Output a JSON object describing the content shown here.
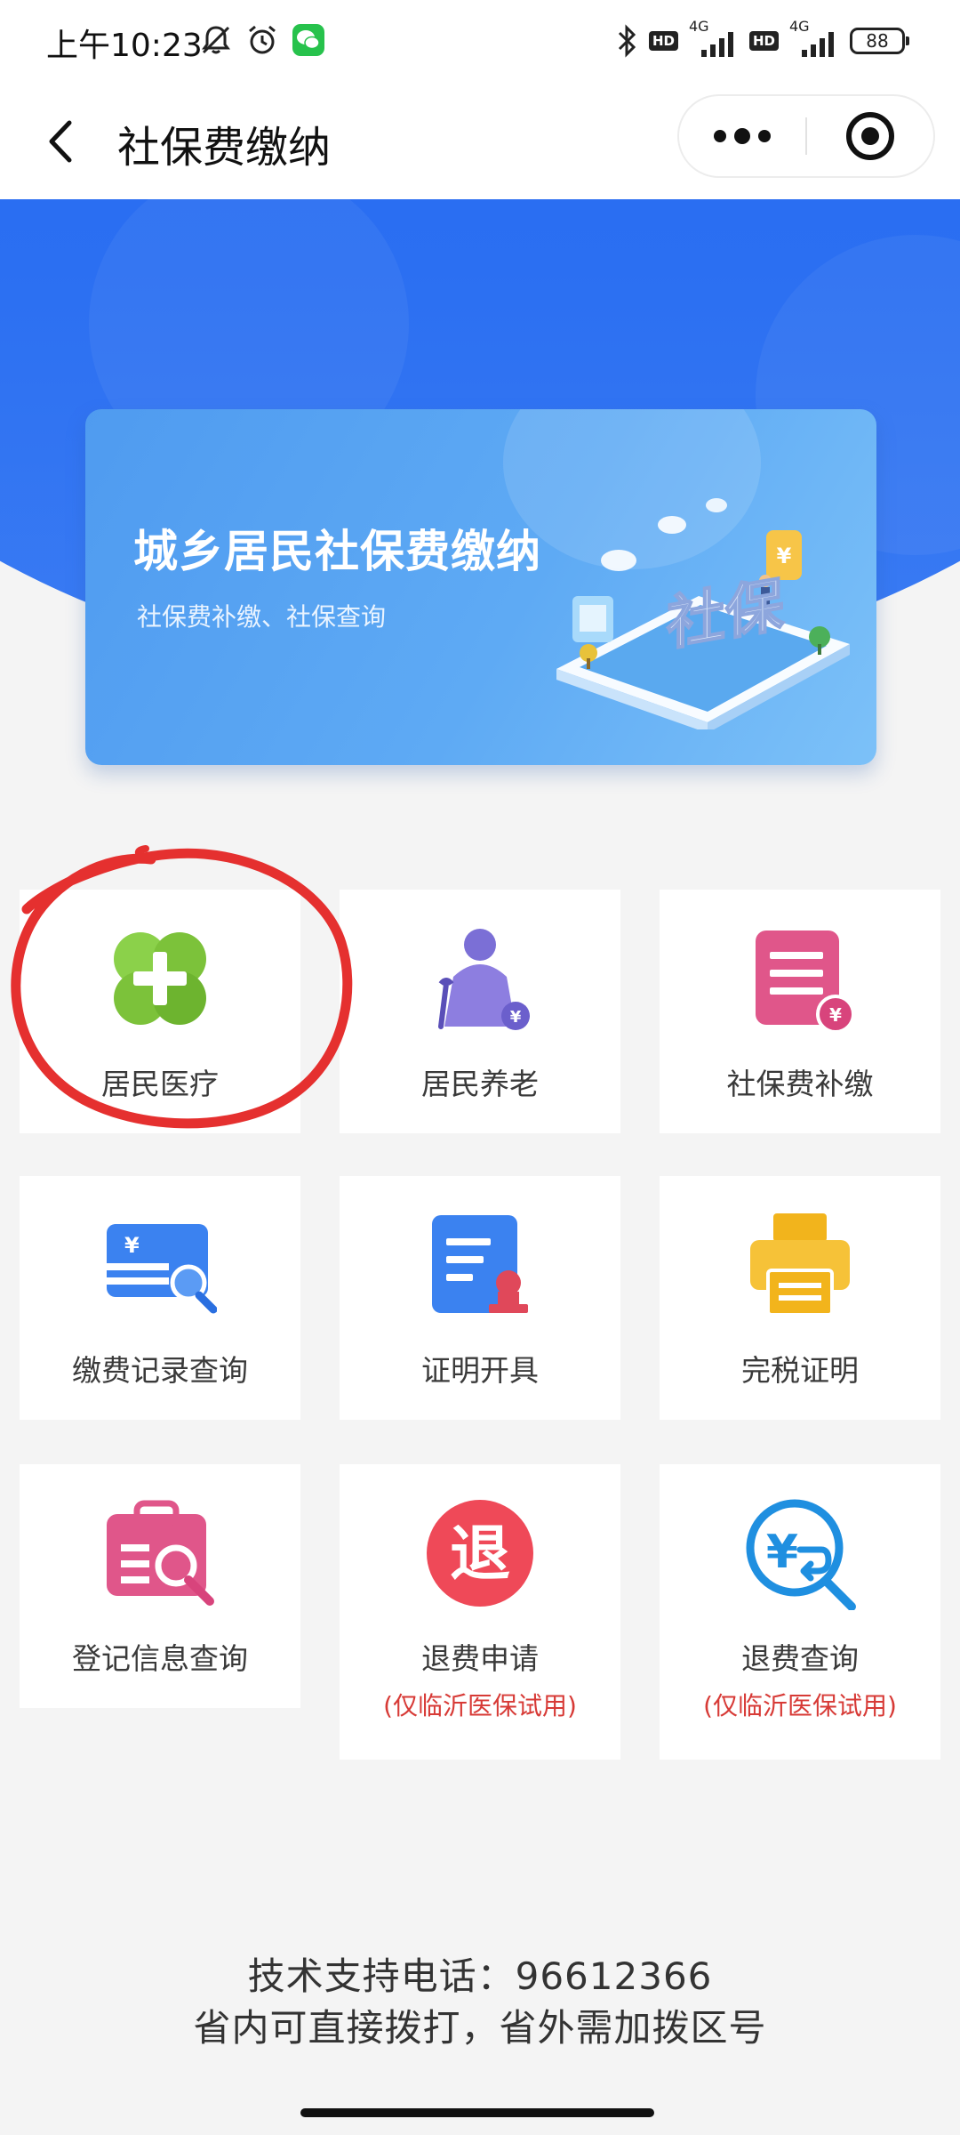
{
  "status_bar": {
    "time": "上午10:23",
    "network_1": "4G",
    "network_2": "4G",
    "hd_1": "HD",
    "hd_2": "HD",
    "battery": "88",
    "icons": [
      "silent-bell-icon",
      "alarm-icon",
      "wechat-icon",
      "bluetooth-icon",
      "signal-icon",
      "battery-icon"
    ]
  },
  "nav": {
    "title": "社保费缴纳",
    "icons": [
      "back-arrow-icon",
      "more-dots-icon",
      "target-close-icon"
    ]
  },
  "banner": {
    "title": "城乡居民社保费缴纳",
    "subtitle": "社保费补缴、社保查询",
    "illustration_text": "社保"
  },
  "tiles": [
    {
      "label": "居民医疗",
      "icon": "clover-cross-icon",
      "note": ""
    },
    {
      "label": "居民养老",
      "icon": "elderly-person-icon",
      "note": ""
    },
    {
      "label": "社保费补缴",
      "icon": "document-yuan-icon",
      "note": ""
    },
    {
      "label": "缴费记录查询",
      "icon": "card-search-icon",
      "note": ""
    },
    {
      "label": "证明开具",
      "icon": "certificate-stamp-icon",
      "note": ""
    },
    {
      "label": "完税证明",
      "icon": "printer-icon",
      "note": ""
    },
    {
      "label": "登记信息查询",
      "icon": "clipboard-search-icon",
      "note": ""
    },
    {
      "label": "退费申请",
      "icon": "refund-badge-icon",
      "note": "(仅临沂医保试用)",
      "badge_char": "退"
    },
    {
      "label": "退费查询",
      "icon": "yuan-search-icon",
      "note": "(仅临沂医保试用)"
    }
  ],
  "footer": {
    "line1": "技术支持电话：96612366",
    "line2": "省内可直接拨打，省外需加拨区号"
  },
  "colors": {
    "primary_blue": "#2468f2",
    "banner_blue": "#5aa6f3",
    "green": "#7cc23a",
    "purple": "#7b6fd6",
    "pink": "#e0568a",
    "yellow": "#f2b41c",
    "red_note": "#d73a36",
    "annotation_red": "#e5302f"
  }
}
